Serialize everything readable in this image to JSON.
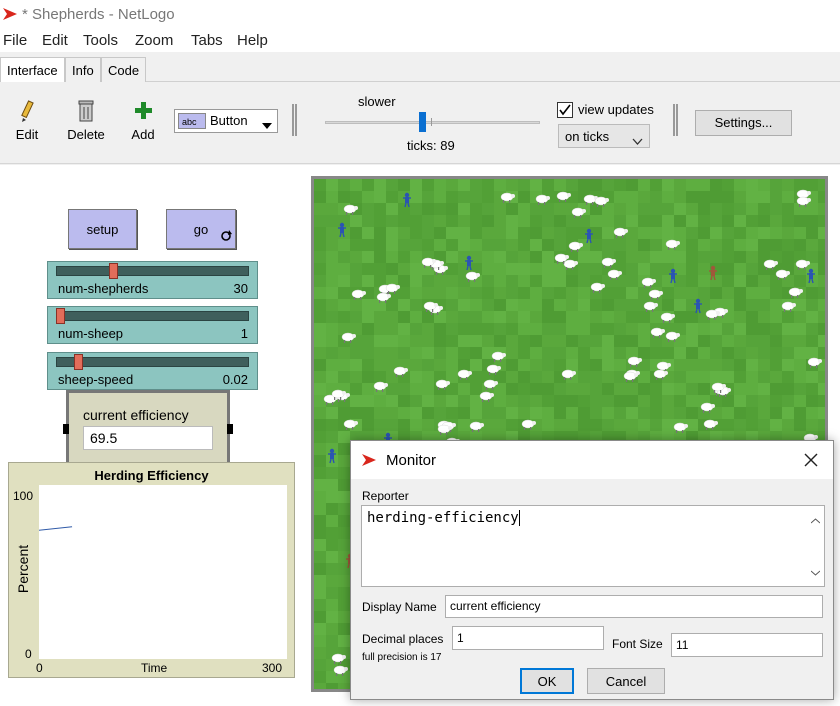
{
  "window": {
    "title": "* Shepherds - NetLogo"
  },
  "menu": [
    "File",
    "Edit",
    "Tools",
    "Zoom",
    "Tabs",
    "Help"
  ],
  "tabs": [
    "Interface",
    "Info",
    "Code"
  ],
  "toolbar": {
    "edit_label": "Edit",
    "delete_label": "Delete",
    "add_label": "Add",
    "widget_type": "Button",
    "widget_type_icon_text": "abc",
    "speed_label": "slower",
    "ticks_label": "ticks: 89",
    "view_updates_label": "view updates",
    "view_updates_checked": true,
    "update_mode": "on ticks",
    "settings_label": "Settings..."
  },
  "buttons": {
    "setup": "setup",
    "go": "go"
  },
  "sliders": [
    {
      "name": "num-shepherds",
      "value": "30",
      "fraction": 0.29
    },
    {
      "name": "num-sheep",
      "value": "1",
      "fraction": 0.0
    },
    {
      "name": "sheep-speed",
      "value": "0.02",
      "fraction": 0.1
    }
  ],
  "monitor": {
    "label": "current efficiency",
    "value": "69.5"
  },
  "plot": {
    "title": "Herding Efficiency",
    "ylabel": "Percent",
    "xlabel": "Time",
    "ymax": "100",
    "ymin": "0",
    "xmin": "0",
    "xmax": "300"
  },
  "chart_data": {
    "type": "line",
    "title": "Herding Efficiency",
    "xlabel": "Time",
    "ylabel": "Percent",
    "xlim": [
      0,
      300
    ],
    "ylim": [
      0,
      100
    ],
    "series": [
      {
        "x": [
          0,
          40
        ],
        "y": [
          74,
          76
        ]
      }
    ]
  },
  "dialog": {
    "title": "Monitor",
    "reporter_label": "Reporter",
    "reporter_value": "herding-efficiency",
    "display_name_label": "Display Name",
    "display_name_value": "current efficiency",
    "decimal_places_label": "Decimal places",
    "decimal_places_value": "1",
    "precision_note": "full precision is 17",
    "font_size_label": "Font Size",
    "font_size_value": "11",
    "ok_label": "OK",
    "cancel_label": "Cancel"
  },
  "colors": {
    "button_bg": "#bbbbee",
    "slider_bg": "#8cc5c0",
    "monitor_bg": "#d8d8c0",
    "world_bg": "#5aa83c",
    "shepherd": "#2b54b3",
    "sheep": "#ffffff"
  }
}
